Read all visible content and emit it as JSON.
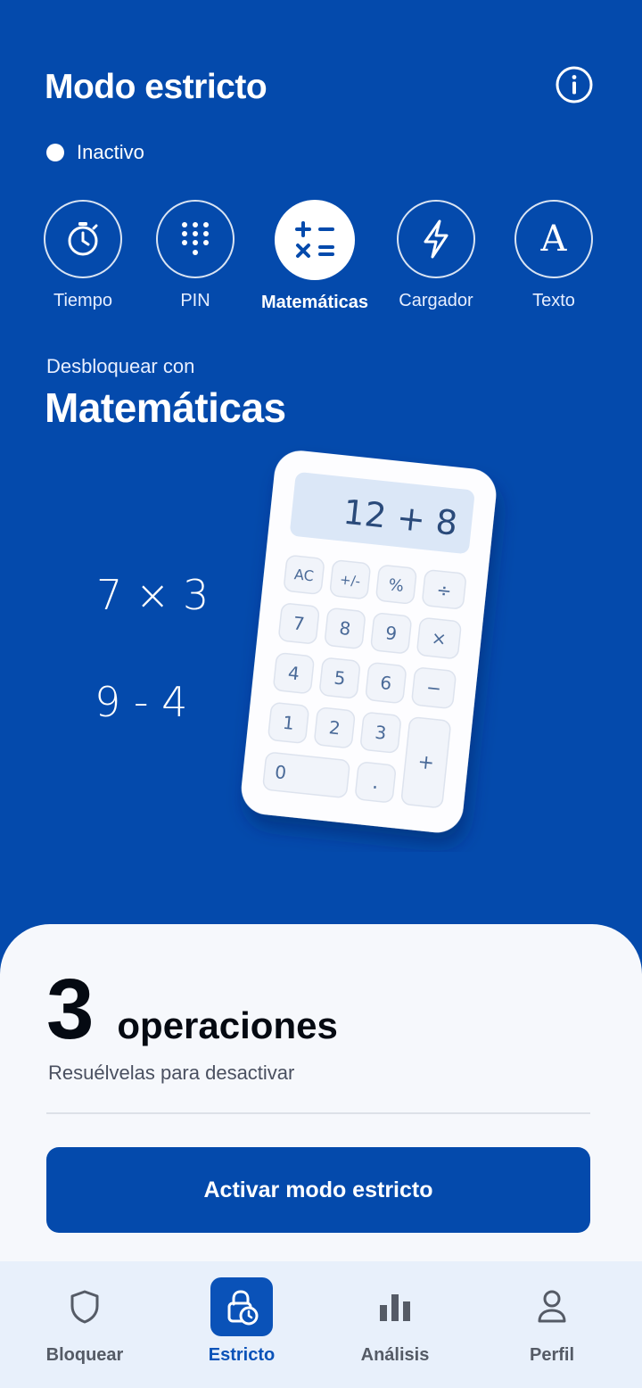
{
  "header": {
    "title": "Modo estricto",
    "info_icon": "info-icon"
  },
  "status": {
    "label": "Inactivo"
  },
  "modes": [
    {
      "label": "Tiempo",
      "icon": "stopwatch-icon",
      "active": false
    },
    {
      "label": "PIN",
      "icon": "keypad-icon",
      "active": false
    },
    {
      "label": "Matemáticas",
      "icon": "math-operators-icon",
      "active": true
    },
    {
      "label": "Cargador",
      "icon": "lightning-icon",
      "active": false
    },
    {
      "label": "Texto",
      "icon": "letter-a-icon",
      "active": false
    }
  ],
  "unlock": {
    "subtitle": "Desbloquear con",
    "method": "Matemáticas"
  },
  "illustration": {
    "handwritten": [
      "7 × 3",
      "9 - 4"
    ],
    "calculator_display": "12 + 8",
    "keys": [
      "AC",
      "+/-",
      "%",
      "÷",
      "7",
      "8",
      "9",
      "×",
      "4",
      "5",
      "6",
      "−",
      "1",
      "2",
      "3",
      "+",
      "0",
      "."
    ]
  },
  "card": {
    "count": "3",
    "count_unit": "operaciones",
    "subtitle": "Resuélvelas para desactivar",
    "button_label": "Activar modo estricto"
  },
  "tabbar": [
    {
      "label": "Bloquear",
      "icon": "shield-icon",
      "active": false
    },
    {
      "label": "Estricto",
      "icon": "lock-clock-icon",
      "active": true
    },
    {
      "label": "Análisis",
      "icon": "bar-chart-icon",
      "active": false
    },
    {
      "label": "Perfil",
      "icon": "person-icon",
      "active": false
    }
  ],
  "colors": {
    "primary": "#044aac",
    "card_bg": "#f6f8fc",
    "tabbar_bg": "#e8f0fb",
    "active_tab": "#0a52b8"
  }
}
